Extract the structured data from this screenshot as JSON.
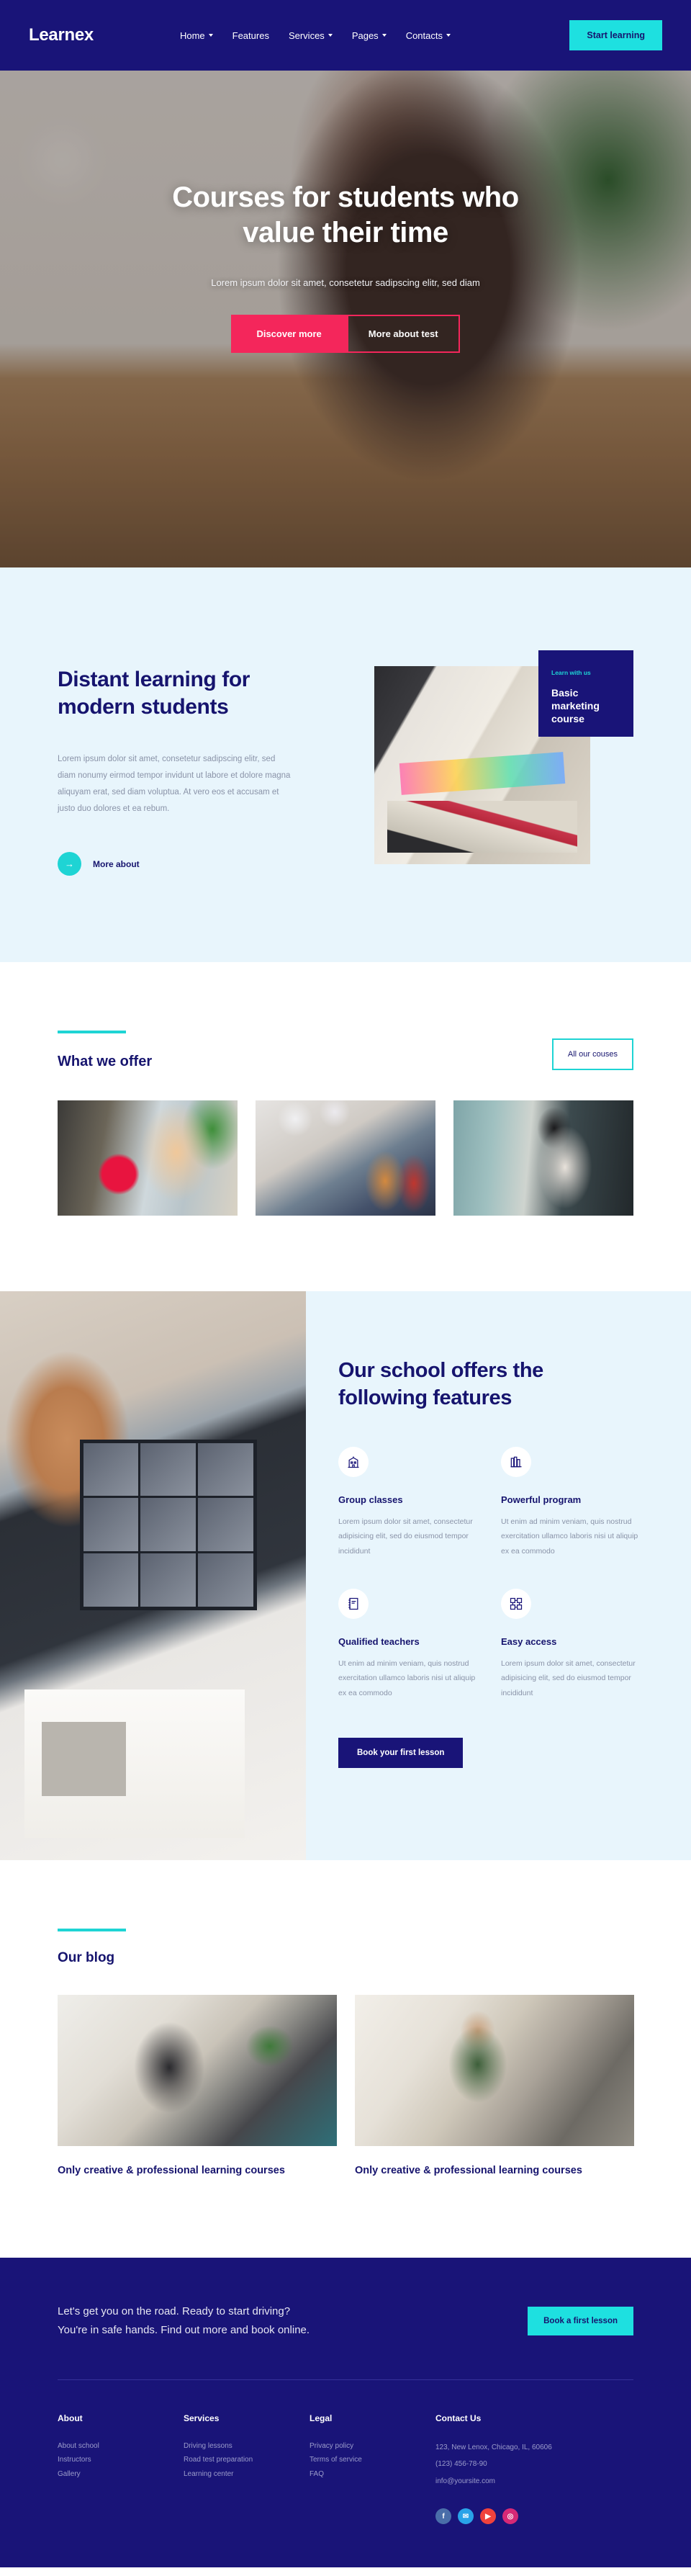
{
  "header": {
    "logo": "Learnex",
    "nav": [
      {
        "label": "Home",
        "caret": true
      },
      {
        "label": "Features",
        "caret": false
      },
      {
        "label": "Services",
        "caret": true
      },
      {
        "label": "Pages",
        "caret": true
      },
      {
        "label": "Contacts",
        "caret": true
      }
    ],
    "cta_label": "Start learning",
    "cta_color": "#1ee0e0",
    "bg_color": "#191478"
  },
  "hero": {
    "title_line1": "Courses for students who",
    "title_line2": "value their time",
    "subtitle": "Lorem ipsum dolor sit amet, consetetur sadipscing elitr, sed diam",
    "primary_label": "Discover more",
    "secondary_label": "More about test",
    "accent_color": "#f4265b"
  },
  "distant": {
    "title_line1": "Distant learning for",
    "title_line2": "modern students",
    "body": "Lorem ipsum dolor sit amet, consetetur sadipscing elitr, sed diam nonumy eirmod tempor invidunt ut labore et dolore magna aliquyam erat, sed diam voluptua. At vero eos et accusam et justo duo dolores et ea rebum.",
    "more_label": "More about",
    "arrow_icon": "→",
    "bg_color": "#e8f5fc",
    "card": {
      "eyebrow": "Learn with us",
      "title": "Basic marketing course",
      "bg_color": "#191478",
      "eyebrow_color": "#1ed4d4"
    }
  },
  "offer": {
    "heading": "What we offer",
    "all_courses_label": "All our couses",
    "accent_color": "#1ed4d4",
    "cards": [
      {
        "name": "florist-course-image"
      },
      {
        "name": "friends-celebration-course-image"
      },
      {
        "name": "photography-course-image"
      }
    ]
  },
  "features": {
    "title_line1": "Our school offers the",
    "title_line2": "following features",
    "bg_color": "#e8f5fc",
    "items": [
      {
        "icon": "school-building-icon",
        "title": "Group classes",
        "body": "Lorem ipsum dolor sit amet, consectetur adipisicing elit, sed do eiusmod tempor incididunt"
      },
      {
        "icon": "books-icon",
        "title": "Powerful program",
        "body": "Ut enim ad minim veniam, quis nostrud exercitation ullamco laboris nisi ut aliquip ex ea commodo"
      },
      {
        "icon": "notebook-icon",
        "title": "Qualified teachers",
        "body": "Ut enim ad minim veniam, quis nostrud exercitation ullamco laboris nisi ut aliquip ex ea commodo"
      },
      {
        "icon": "qr-grid-icon",
        "title": "Easy access",
        "body": "Lorem ipsum dolor sit amet, consectetur adipisicing elit, sed do eiusmod tempor incididunt"
      }
    ],
    "book_label": "Book your first lesson"
  },
  "blog": {
    "heading": "Our blog",
    "accent_color": "#1ed4d4",
    "posts": [
      {
        "thumb": "yoga-stretching-photo",
        "title": "Only creative & professional learning courses"
      },
      {
        "thumb": "woman-with-phone-photo",
        "title": "Only creative & professional learning courses"
      }
    ]
  },
  "cta": {
    "line1": "Let's get you on the road. Ready to start driving?",
    "line2": "You're in safe hands. Find out more and book online.",
    "button_label": "Book a first lesson",
    "button_color": "#1ee0e0",
    "bg_color": "#191478"
  },
  "footer": {
    "columns": [
      {
        "title": "About",
        "links": [
          "About school",
          "Instructors",
          "Gallery"
        ]
      },
      {
        "title": "Services",
        "links": [
          "Driving lessons",
          "Road test preparation",
          "Learning center"
        ]
      },
      {
        "title": "Legal",
        "links": [
          "Privacy policy",
          "Terms of service",
          "FAQ"
        ]
      }
    ],
    "contact": {
      "title": "Contact Us",
      "lines": [
        "123, New Lenox, Chicago, IL, 60606",
        "(123) 456-78-90",
        "info@yoursite.com"
      ]
    },
    "socials": [
      {
        "name": "facebook-icon",
        "glyph": "f",
        "color": "#4a6ea9"
      },
      {
        "name": "twitter-icon",
        "glyph": "✉",
        "color": "#29a3e8"
      },
      {
        "name": "youtube-icon",
        "glyph": "▶",
        "color": "#f0423c"
      },
      {
        "name": "instagram-icon",
        "glyph": "◎",
        "color": "#d62976"
      }
    ]
  }
}
